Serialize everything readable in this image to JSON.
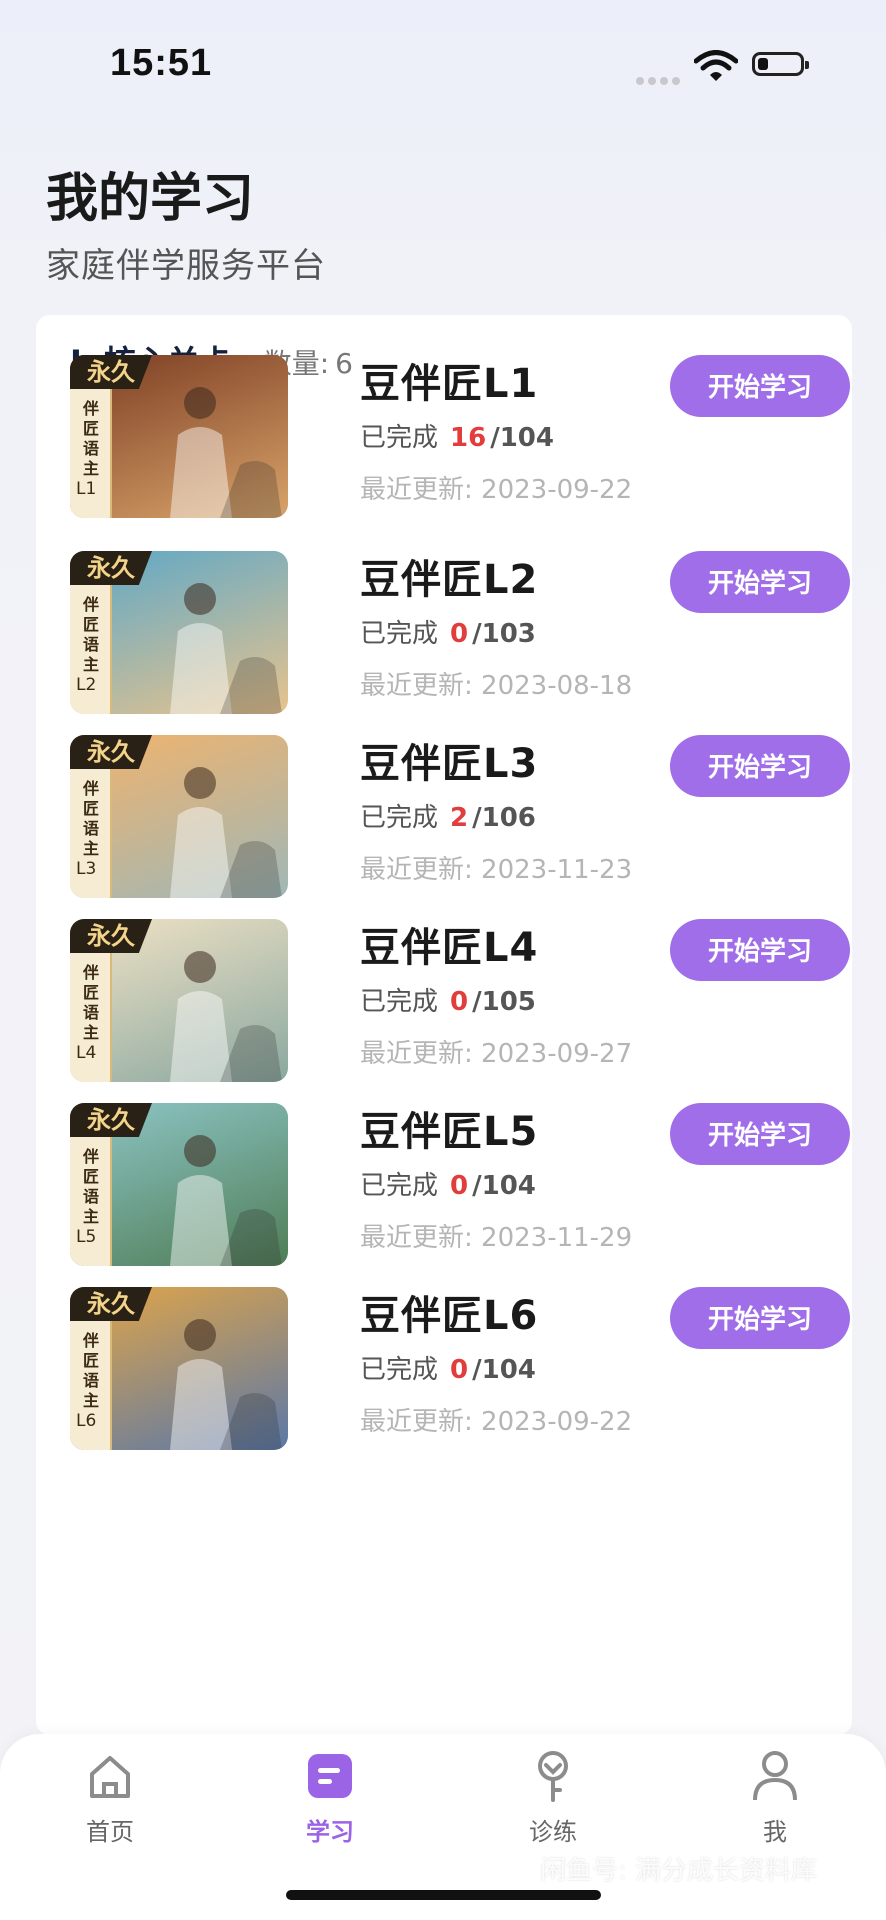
{
  "status": {
    "time": "15:51"
  },
  "header": {
    "title": "我的学习",
    "subtitle": "家庭伴学服务平台"
  },
  "section": {
    "title": "L-核心关卡",
    "count_label": "数量:",
    "count": "6"
  },
  "thumb_common": {
    "badge": "永久",
    "series": "伴匠语主"
  },
  "courses": [
    {
      "name": "豆伴匠L1",
      "level": "L1",
      "done_label": "已完成",
      "done": "16",
      "total": "/104",
      "updated": "最近更新: 2023-09-22",
      "button": "开始学习",
      "colors": [
        "#7a3b22",
        "#d9a46a"
      ]
    },
    {
      "name": "豆伴匠L2",
      "level": "L2",
      "done_label": "已完成",
      "done": "0",
      "total": "/103",
      "updated": "最近更新: 2023-08-18",
      "button": "开始学习",
      "colors": [
        "#5aa7c9",
        "#e7c38d"
      ]
    },
    {
      "name": "豆伴匠L3",
      "level": "L3",
      "done_label": "已完成",
      "done": "2",
      "total": "/106",
      "updated": "最近更新: 2023-11-23",
      "button": "开始学习",
      "colors": [
        "#f2b36b",
        "#9fb7b7"
      ]
    },
    {
      "name": "豆伴匠L4",
      "level": "L4",
      "done_label": "已完成",
      "done": "0",
      "total": "/105",
      "updated": "最近更新: 2023-09-27",
      "button": "开始学习",
      "colors": [
        "#f2e3c6",
        "#8aa8a0"
      ]
    },
    {
      "name": "豆伴匠L5",
      "level": "L5",
      "done_label": "已完成",
      "done": "0",
      "total": "/104",
      "updated": "最近更新: 2023-11-29",
      "button": "开始学习",
      "colors": [
        "#8fc7c9",
        "#4f7d55"
      ]
    },
    {
      "name": "豆伴匠L6",
      "level": "L6",
      "done_label": "已完成",
      "done": "0",
      "total": "/104",
      "updated": "最近更新: 2023-09-22",
      "button": "开始学习",
      "colors": [
        "#e4a646",
        "#5a78a8"
      ]
    }
  ],
  "tabs": [
    {
      "label": "首页",
      "icon": "home-icon"
    },
    {
      "label": "学习",
      "icon": "study-icon"
    },
    {
      "label": "诊练",
      "icon": "key-icon"
    },
    {
      "label": "我",
      "icon": "person-icon"
    }
  ],
  "watermark": "闲鱼号: 满分成长资料库",
  "accent": "#a06ee9"
}
